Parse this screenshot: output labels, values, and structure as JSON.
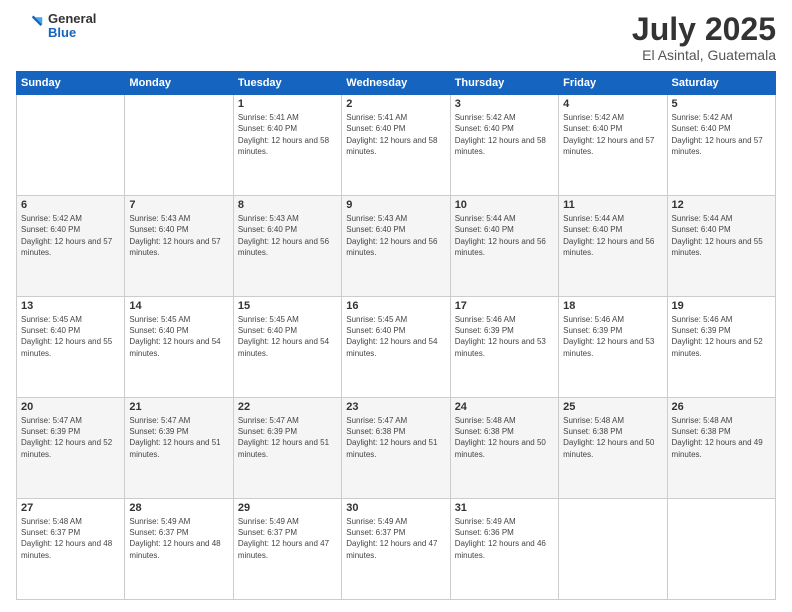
{
  "header": {
    "logo_general": "General",
    "logo_blue": "Blue",
    "month_title": "July 2025",
    "location": "El Asintal, Guatemala"
  },
  "weekdays": [
    "Sunday",
    "Monday",
    "Tuesday",
    "Wednesday",
    "Thursday",
    "Friday",
    "Saturday"
  ],
  "weeks": [
    [
      {
        "day": "",
        "info": ""
      },
      {
        "day": "",
        "info": ""
      },
      {
        "day": "1",
        "info": "Sunrise: 5:41 AM\nSunset: 6:40 PM\nDaylight: 12 hours and 58 minutes."
      },
      {
        "day": "2",
        "info": "Sunrise: 5:41 AM\nSunset: 6:40 PM\nDaylight: 12 hours and 58 minutes."
      },
      {
        "day": "3",
        "info": "Sunrise: 5:42 AM\nSunset: 6:40 PM\nDaylight: 12 hours and 58 minutes."
      },
      {
        "day": "4",
        "info": "Sunrise: 5:42 AM\nSunset: 6:40 PM\nDaylight: 12 hours and 57 minutes."
      },
      {
        "day": "5",
        "info": "Sunrise: 5:42 AM\nSunset: 6:40 PM\nDaylight: 12 hours and 57 minutes."
      }
    ],
    [
      {
        "day": "6",
        "info": "Sunrise: 5:42 AM\nSunset: 6:40 PM\nDaylight: 12 hours and 57 minutes."
      },
      {
        "day": "7",
        "info": "Sunrise: 5:43 AM\nSunset: 6:40 PM\nDaylight: 12 hours and 57 minutes."
      },
      {
        "day": "8",
        "info": "Sunrise: 5:43 AM\nSunset: 6:40 PM\nDaylight: 12 hours and 56 minutes."
      },
      {
        "day": "9",
        "info": "Sunrise: 5:43 AM\nSunset: 6:40 PM\nDaylight: 12 hours and 56 minutes."
      },
      {
        "day": "10",
        "info": "Sunrise: 5:44 AM\nSunset: 6:40 PM\nDaylight: 12 hours and 56 minutes."
      },
      {
        "day": "11",
        "info": "Sunrise: 5:44 AM\nSunset: 6:40 PM\nDaylight: 12 hours and 56 minutes."
      },
      {
        "day": "12",
        "info": "Sunrise: 5:44 AM\nSunset: 6:40 PM\nDaylight: 12 hours and 55 minutes."
      }
    ],
    [
      {
        "day": "13",
        "info": "Sunrise: 5:45 AM\nSunset: 6:40 PM\nDaylight: 12 hours and 55 minutes."
      },
      {
        "day": "14",
        "info": "Sunrise: 5:45 AM\nSunset: 6:40 PM\nDaylight: 12 hours and 54 minutes."
      },
      {
        "day": "15",
        "info": "Sunrise: 5:45 AM\nSunset: 6:40 PM\nDaylight: 12 hours and 54 minutes."
      },
      {
        "day": "16",
        "info": "Sunrise: 5:45 AM\nSunset: 6:40 PM\nDaylight: 12 hours and 54 minutes."
      },
      {
        "day": "17",
        "info": "Sunrise: 5:46 AM\nSunset: 6:39 PM\nDaylight: 12 hours and 53 minutes."
      },
      {
        "day": "18",
        "info": "Sunrise: 5:46 AM\nSunset: 6:39 PM\nDaylight: 12 hours and 53 minutes."
      },
      {
        "day": "19",
        "info": "Sunrise: 5:46 AM\nSunset: 6:39 PM\nDaylight: 12 hours and 52 minutes."
      }
    ],
    [
      {
        "day": "20",
        "info": "Sunrise: 5:47 AM\nSunset: 6:39 PM\nDaylight: 12 hours and 52 minutes."
      },
      {
        "day": "21",
        "info": "Sunrise: 5:47 AM\nSunset: 6:39 PM\nDaylight: 12 hours and 51 minutes."
      },
      {
        "day": "22",
        "info": "Sunrise: 5:47 AM\nSunset: 6:39 PM\nDaylight: 12 hours and 51 minutes."
      },
      {
        "day": "23",
        "info": "Sunrise: 5:47 AM\nSunset: 6:38 PM\nDaylight: 12 hours and 51 minutes."
      },
      {
        "day": "24",
        "info": "Sunrise: 5:48 AM\nSunset: 6:38 PM\nDaylight: 12 hours and 50 minutes."
      },
      {
        "day": "25",
        "info": "Sunrise: 5:48 AM\nSunset: 6:38 PM\nDaylight: 12 hours and 50 minutes."
      },
      {
        "day": "26",
        "info": "Sunrise: 5:48 AM\nSunset: 6:38 PM\nDaylight: 12 hours and 49 minutes."
      }
    ],
    [
      {
        "day": "27",
        "info": "Sunrise: 5:48 AM\nSunset: 6:37 PM\nDaylight: 12 hours and 48 minutes."
      },
      {
        "day": "28",
        "info": "Sunrise: 5:49 AM\nSunset: 6:37 PM\nDaylight: 12 hours and 48 minutes."
      },
      {
        "day": "29",
        "info": "Sunrise: 5:49 AM\nSunset: 6:37 PM\nDaylight: 12 hours and 47 minutes."
      },
      {
        "day": "30",
        "info": "Sunrise: 5:49 AM\nSunset: 6:37 PM\nDaylight: 12 hours and 47 minutes."
      },
      {
        "day": "31",
        "info": "Sunrise: 5:49 AM\nSunset: 6:36 PM\nDaylight: 12 hours and 46 minutes."
      },
      {
        "day": "",
        "info": ""
      },
      {
        "day": "",
        "info": ""
      }
    ]
  ]
}
